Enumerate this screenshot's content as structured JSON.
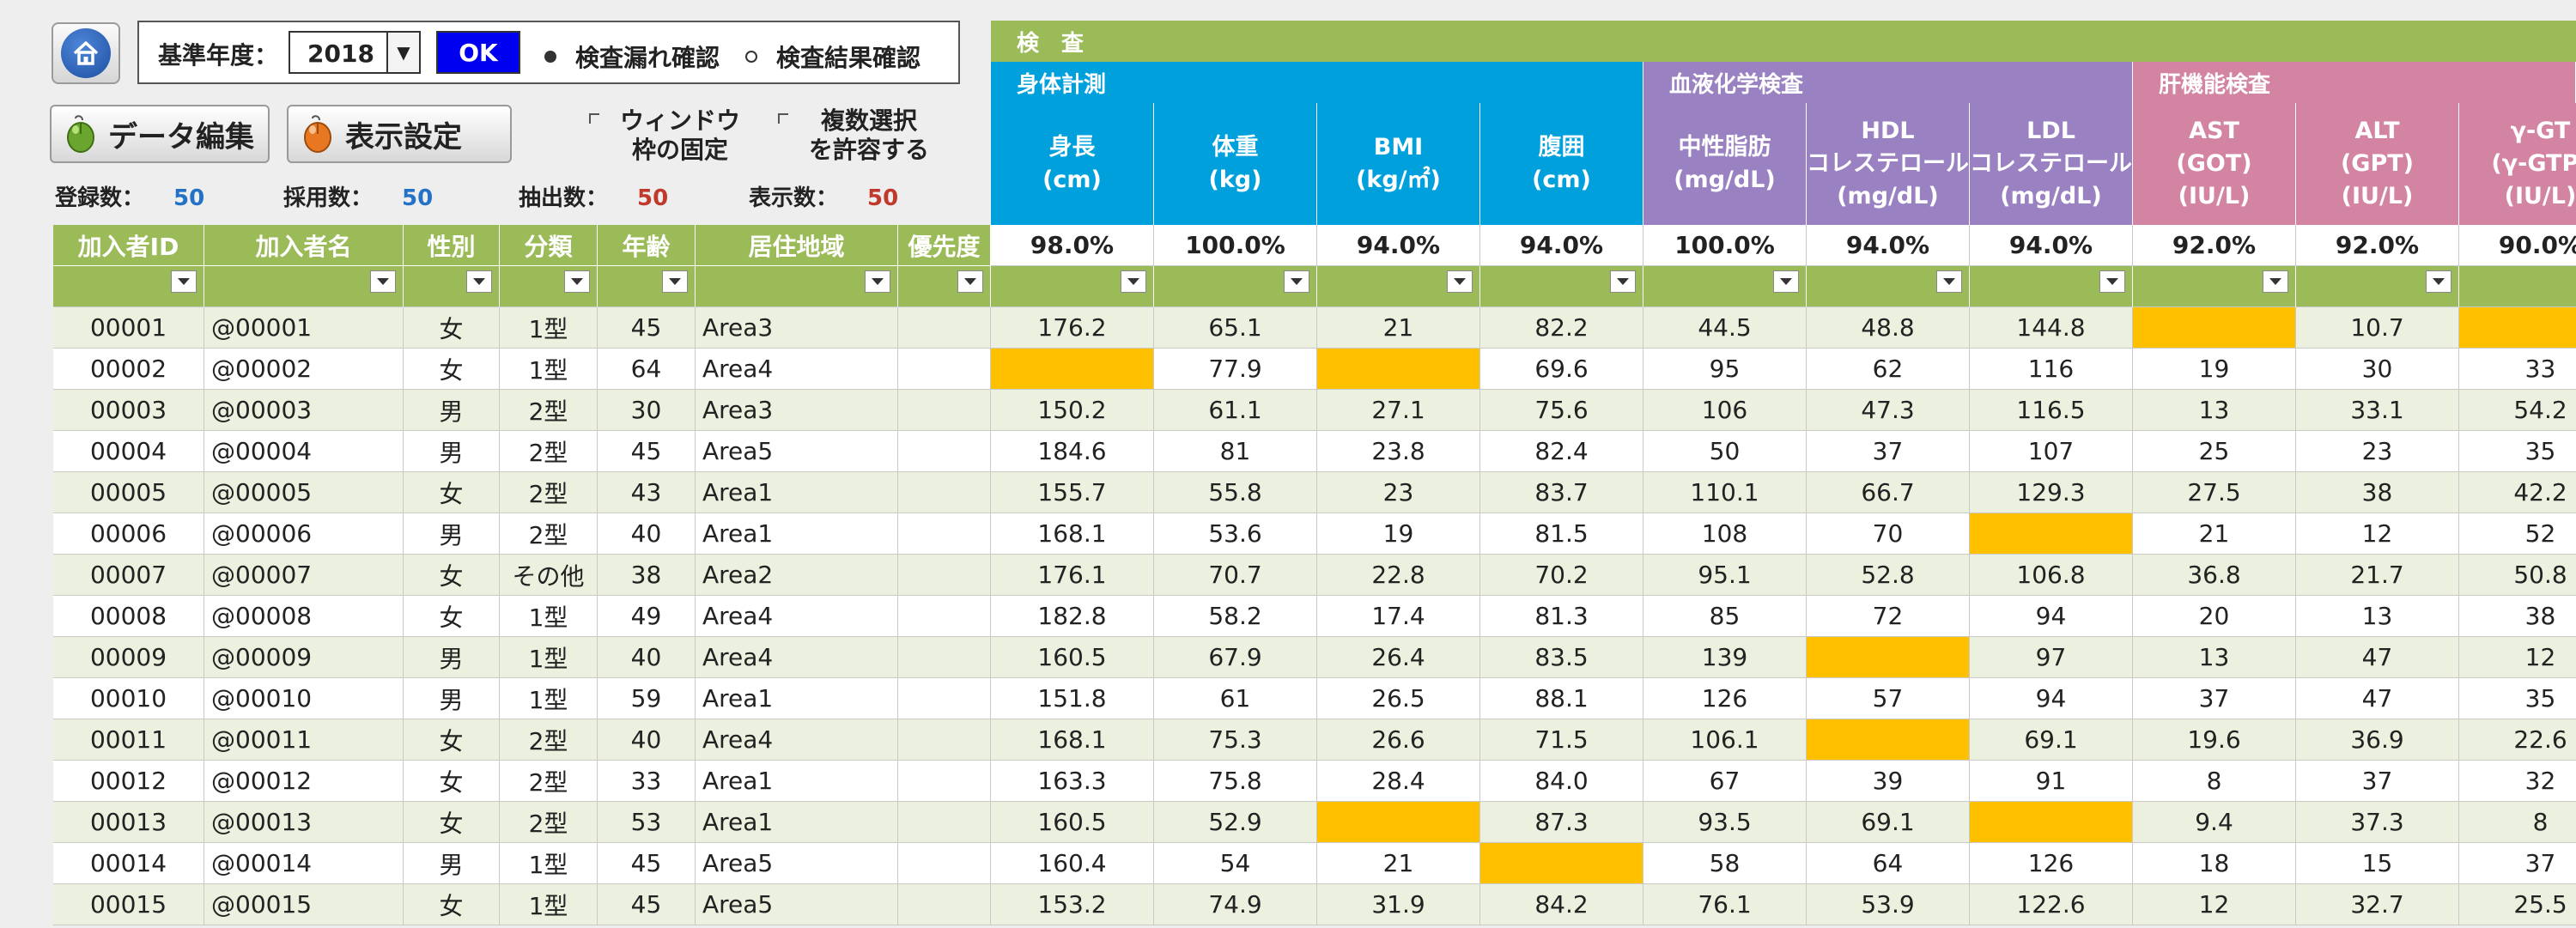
{
  "toolbar": {
    "year_label": "基準年度：",
    "year_value": "2018",
    "ok_label": "OK",
    "radio_missing": "検査漏れ確認",
    "radio_results": "検査結果確認",
    "edit_label": "データ編集",
    "display_label": "表示設定",
    "freeze_label": "ウィンドウ\n枠の固定",
    "multi_label": "複数選択\nを許容する"
  },
  "counts": [
    {
      "label": "登録数：",
      "value": "50",
      "color": "#2471c8"
    },
    {
      "label": "採用数：",
      "value": "50",
      "color": "#2471c8"
    },
    {
      "label": "抽出数：",
      "value": "50",
      "color": "#c0392b"
    },
    {
      "label": "表示数：",
      "value": "50",
      "color": "#c0392b"
    }
  ],
  "top_band": "検　査",
  "groups": [
    {
      "label": "身体計測",
      "color": "#00a0dc"
    },
    {
      "label": "血液化学検査",
      "color": "#9a82c2"
    },
    {
      "label": "肝機能検査",
      "color": "#d384a3"
    }
  ],
  "left_headers": [
    "加入者ID",
    "加入者名",
    "性別",
    "分類",
    "年齢",
    "居住地域",
    "優先度"
  ],
  "test_headers": [
    {
      "label": "身長\n(cm)",
      "group": 0
    },
    {
      "label": "体重\n(kg)",
      "group": 0
    },
    {
      "label": "BMI\n(kg/㎡)",
      "group": 0
    },
    {
      "label": "腹囲\n(cm)",
      "group": 0
    },
    {
      "label": "中性脂肪\n(mg/dL)",
      "group": 1
    },
    {
      "label": "HDL\nコレステロール\n(mg/dL)",
      "group": 1
    },
    {
      "label": "LDL\nコレステロール\n(mg/dL)",
      "group": 1
    },
    {
      "label": "AST\n(GOT)\n(IU/L)",
      "group": 2
    },
    {
      "label": "ALT\n(GPT)\n(IU/L)",
      "group": 2
    },
    {
      "label": "γ-GT\n(γ-GTP)\n(IU/L)",
      "group": 2
    }
  ],
  "rates": [
    "98.0%",
    "100.0%",
    "94.0%",
    "94.0%",
    "100.0%",
    "94.0%",
    "94.0%",
    "92.0%",
    "92.0%",
    "90.0%"
  ],
  "rows": [
    {
      "id": "00001",
      "name": "@00001",
      "sex": "女",
      "type": "1型",
      "age": "45",
      "area": "Area3",
      "vals": [
        "176.2",
        "65.1",
        "21",
        "82.2",
        "44.5",
        "48.8",
        "144.8",
        "",
        "10.7",
        ""
      ]
    },
    {
      "id": "00002",
      "name": "@00002",
      "sex": "女",
      "type": "1型",
      "age": "64",
      "area": "Area4",
      "vals": [
        "",
        "77.9",
        "",
        "69.6",
        "95",
        "62",
        "116",
        "19",
        "30",
        "33"
      ]
    },
    {
      "id": "00003",
      "name": "@00003",
      "sex": "男",
      "type": "2型",
      "age": "30",
      "area": "Area3",
      "vals": [
        "150.2",
        "61.1",
        "27.1",
        "75.6",
        "106",
        "47.3",
        "116.5",
        "13",
        "33.1",
        "54.2"
      ]
    },
    {
      "id": "00004",
      "name": "@00004",
      "sex": "男",
      "type": "2型",
      "age": "45",
      "area": "Area5",
      "vals": [
        "184.6",
        "81",
        "23.8",
        "82.4",
        "50",
        "37",
        "107",
        "25",
        "23",
        "35"
      ]
    },
    {
      "id": "00005",
      "name": "@00005",
      "sex": "女",
      "type": "2型",
      "age": "43",
      "area": "Area1",
      "vals": [
        "155.7",
        "55.8",
        "23",
        "83.7",
        "110.1",
        "66.7",
        "129.3",
        "27.5",
        "38",
        "42.2"
      ]
    },
    {
      "id": "00006",
      "name": "@00006",
      "sex": "男",
      "type": "2型",
      "age": "40",
      "area": "Area1",
      "vals": [
        "168.1",
        "53.6",
        "19",
        "81.5",
        "108",
        "70",
        "",
        "21",
        "12",
        "52"
      ]
    },
    {
      "id": "00007",
      "name": "@00007",
      "sex": "女",
      "type": "その他",
      "age": "38",
      "area": "Area2",
      "vals": [
        "176.1",
        "70.7",
        "22.8",
        "70.2",
        "95.1",
        "52.8",
        "106.8",
        "36.8",
        "21.7",
        "50.8"
      ]
    },
    {
      "id": "00008",
      "name": "@00008",
      "sex": "女",
      "type": "1型",
      "age": "49",
      "area": "Area4",
      "vals": [
        "182.8",
        "58.2",
        "17.4",
        "81.3",
        "85",
        "72",
        "94",
        "20",
        "13",
        "38"
      ]
    },
    {
      "id": "00009",
      "name": "@00009",
      "sex": "男",
      "type": "1型",
      "age": "40",
      "area": "Area4",
      "vals": [
        "160.5",
        "67.9",
        "26.4",
        "83.5",
        "139",
        "",
        "97",
        "13",
        "47",
        "12"
      ]
    },
    {
      "id": "00010",
      "name": "@00010",
      "sex": "男",
      "type": "1型",
      "age": "59",
      "area": "Area1",
      "vals": [
        "151.8",
        "61",
        "26.5",
        "88.1",
        "126",
        "57",
        "94",
        "37",
        "47",
        "35"
      ]
    },
    {
      "id": "00011",
      "name": "@00011",
      "sex": "女",
      "type": "2型",
      "age": "40",
      "area": "Area4",
      "vals": [
        "168.1",
        "75.3",
        "26.6",
        "71.5",
        "106.1",
        "",
        "69.1",
        "19.6",
        "36.9",
        "22.6"
      ]
    },
    {
      "id": "00012",
      "name": "@00012",
      "sex": "女",
      "type": "2型",
      "age": "33",
      "area": "Area1",
      "vals": [
        "163.3",
        "75.8",
        "28.4",
        "84.0",
        "67",
        "39",
        "91",
        "8",
        "37",
        "32"
      ]
    },
    {
      "id": "00013",
      "name": "@00013",
      "sex": "女",
      "type": "2型",
      "age": "53",
      "area": "Area1",
      "vals": [
        "160.5",
        "52.9",
        "",
        "87.3",
        "93.5",
        "69.1",
        "",
        "9.4",
        "37.3",
        "8"
      ]
    },
    {
      "id": "00014",
      "name": "@00014",
      "sex": "男",
      "type": "1型",
      "age": "45",
      "area": "Area5",
      "vals": [
        "160.4",
        "54",
        "21",
        "",
        "58",
        "64",
        "126",
        "18",
        "15",
        "37"
      ]
    },
    {
      "id": "00015",
      "name": "@00015",
      "sex": "女",
      "type": "1型",
      "age": "45",
      "area": "Area5",
      "vals": [
        "153.2",
        "74.9",
        "31.9",
        "84.2",
        "76.1",
        "53.9",
        "122.6",
        "12",
        "32.7",
        "25.5"
      ]
    }
  ],
  "colors": {
    "header_green": "#9bbb59",
    "row_even": "#ebf1de",
    "row_odd": "#ffffff",
    "missing": "#ffc000"
  }
}
